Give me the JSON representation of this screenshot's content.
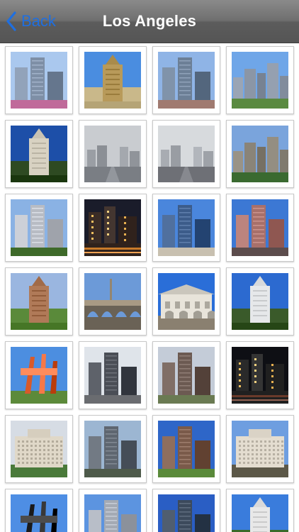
{
  "navbar": {
    "back_label": "Back",
    "title": "Los Angeles"
  },
  "colors": {
    "back_tint": "#1f6fe0",
    "title": "#ffffff"
  },
  "thumbnails": [
    {
      "kind": "towers",
      "sky": "#aac8ee",
      "building": "#7e8fa6",
      "ground": "#c06a9a"
    },
    {
      "kind": "tower",
      "sky": "#4a8de0",
      "building": "#b89a5a",
      "ground": "#c9b88a"
    },
    {
      "kind": "towers",
      "sky": "#8fb4e6",
      "building": "#6c7f96",
      "ground": "#a07a70"
    },
    {
      "kind": "skyline",
      "sky": "#6fa6e8",
      "building": "#8b96a6",
      "ground": "#5a8a40"
    },
    {
      "kind": "tower",
      "sky": "#1d4fa8",
      "building": "#d8d2c2",
      "ground": "#2e4a22"
    },
    {
      "kind": "street",
      "sky": "#c9ccd0",
      "building": "#9a9ea4",
      "ground": "#7a7e84"
    },
    {
      "kind": "street",
      "sky": "#d7dadd",
      "building": "#a8acb2",
      "ground": "#6e7076"
    },
    {
      "kind": "skyline",
      "sky": "#7aa4dc",
      "building": "#8a8478",
      "ground": "#3a6a30"
    },
    {
      "kind": "towers",
      "sky": "#8ab2e4",
      "building": "#b8bcc4",
      "ground": "#3e6a2a"
    },
    {
      "kind": "night",
      "sky": "#1a1c2a",
      "building": "#3a2c26",
      "ground": "#c87a2a"
    },
    {
      "kind": "towers",
      "sky": "#4a86dc",
      "building": "#3c5c8a",
      "ground": "#c8c0b0"
    },
    {
      "kind": "towers",
      "sky": "#3c78d4",
      "building": "#a8706a",
      "ground": "#5c4c4c"
    },
    {
      "kind": "tower",
      "sky": "#9ab6e0",
      "building": "#b07a58",
      "ground": "#5a8a3a"
    },
    {
      "kind": "bridge",
      "sky": "#6c9ad8",
      "building": "#a89a84",
      "ground": "#6a6256"
    },
    {
      "kind": "mission",
      "sky": "#2a6ed8",
      "building": "#e8e4da",
      "ground": "#8a8070"
    },
    {
      "kind": "tower",
      "sky": "#2c6ad0",
      "building": "#e6e8ea",
      "ground": "#3a5a2a"
    },
    {
      "kind": "sculpture",
      "sky": "#4c8ee0",
      "building": "#d85a2a",
      "ground": "#5c8a3a"
    },
    {
      "kind": "towers",
      "sky": "#dfe4ea",
      "building": "#4a4e56",
      "ground": "#6a6c70"
    },
    {
      "kind": "towers",
      "sky": "#c4ccd8",
      "building": "#6c5a52",
      "ground": "#6a7a52"
    },
    {
      "kind": "night",
      "sky": "#0e0f14",
      "building": "#2a2a2a",
      "ground": "#6a3a2a"
    },
    {
      "kind": "hotel",
      "sky": "#d6dce4",
      "building": "#e0d8c8",
      "ground": "#4a7a3a"
    },
    {
      "kind": "towers",
      "sky": "#9cb6d2",
      "building": "#5e6670",
      "ground": "#4e5a4a"
    },
    {
      "kind": "towers",
      "sky": "#2e66c8",
      "building": "#7a5a4a",
      "ground": "#5a8a3a"
    },
    {
      "kind": "hotel",
      "sky": "#6e9ee0",
      "building": "#e4ddd0",
      "ground": "#5c5848"
    },
    {
      "kind": "sculpture",
      "sky": "#4e8ee4",
      "building": "#1a1a1a",
      "ground": "#5a8a3a"
    },
    {
      "kind": "towers",
      "sky": "#5c94e0",
      "building": "#a4aab4",
      "ground": "#3a4a30"
    },
    {
      "kind": "towers",
      "sky": "#2a5ec4",
      "building": "#3c4a5c",
      "ground": "#2a3a4a"
    },
    {
      "kind": "tower",
      "sky": "#3a7cdc",
      "building": "#e8e8e8",
      "ground": "#3a6a2a"
    }
  ]
}
